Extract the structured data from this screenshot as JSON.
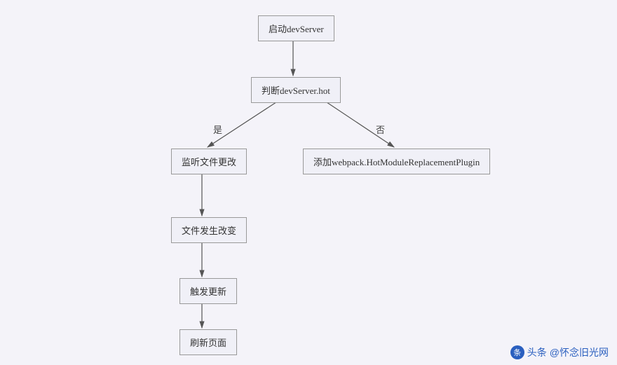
{
  "nodes": {
    "start": "启动devServer",
    "check": "判断devServer.hot",
    "listen": "监听文件更改",
    "changed": "文件发生改变",
    "trigger": "触发更新",
    "refresh": "刷新页面",
    "plugin": "添加webpack.HotModuleReplacementPlugin"
  },
  "edges": {
    "yes": "是",
    "no": "否"
  },
  "watermark": {
    "prefix": "头条",
    "text": "@怀念旧光网"
  }
}
